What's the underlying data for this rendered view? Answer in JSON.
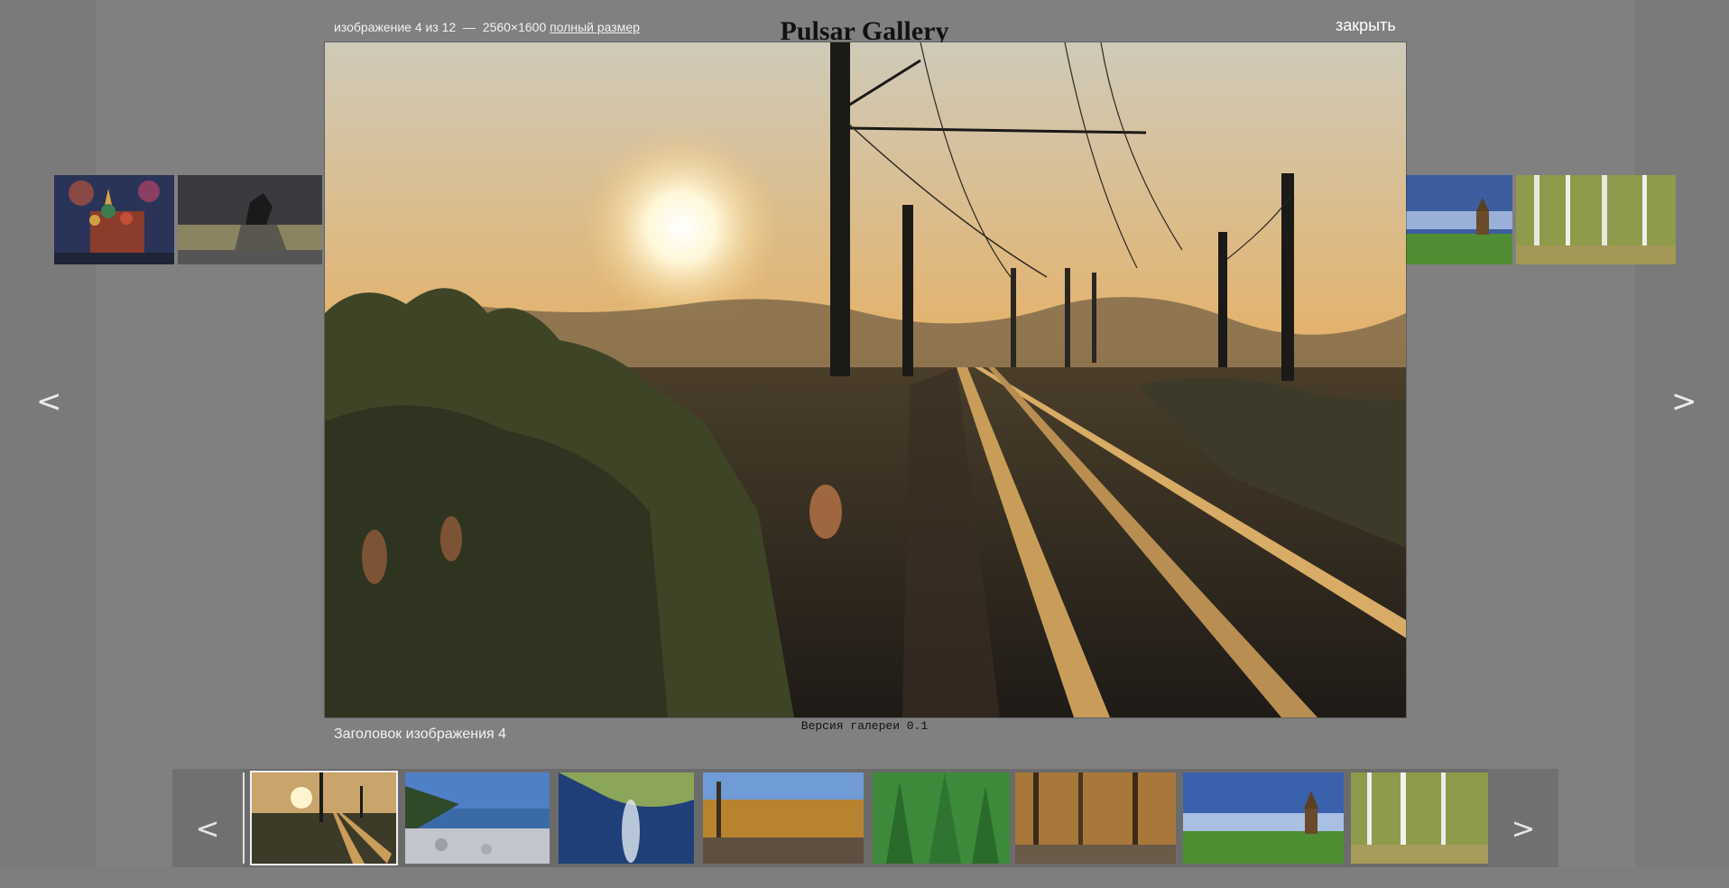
{
  "page": {
    "title": "Pulsar Gallery",
    "version": "Версия галереи 0.1"
  },
  "lightbox": {
    "counter": "изображение 4 из 12",
    "separator": "—",
    "dimensions": "2560×1600",
    "full_size_link": "полный размер",
    "close_label": "закрыть",
    "caption": "Заголовок изображения 4",
    "prev_label": "<",
    "next_label": ">"
  },
  "strip": {
    "prev_label": "<",
    "next_label": ">",
    "thumbnails": [
      {
        "subject": "railway-sunset",
        "active": true
      },
      {
        "subject": "rocky-shore-lake"
      },
      {
        "subject": "water-reflection-leaves"
      },
      {
        "subject": "autumn-river"
      },
      {
        "subject": "green-forest"
      },
      {
        "subject": "autumn-woods"
      },
      {
        "subject": "wooden-church-hill"
      },
      {
        "subject": "birch-grove"
      }
    ]
  },
  "side_thumbnails": {
    "left": [
      "st-basils-fireworks",
      "bronze-horseman"
    ],
    "right": [
      "wooden-church-hill",
      "birch-grove"
    ]
  },
  "colors": {
    "overlay": "#7e7e7e",
    "strip": "#6b6b6b",
    "text_light": "#f2f2f2",
    "sky_top": "#cfcab9",
    "sky_glow": "#e3a94f"
  }
}
